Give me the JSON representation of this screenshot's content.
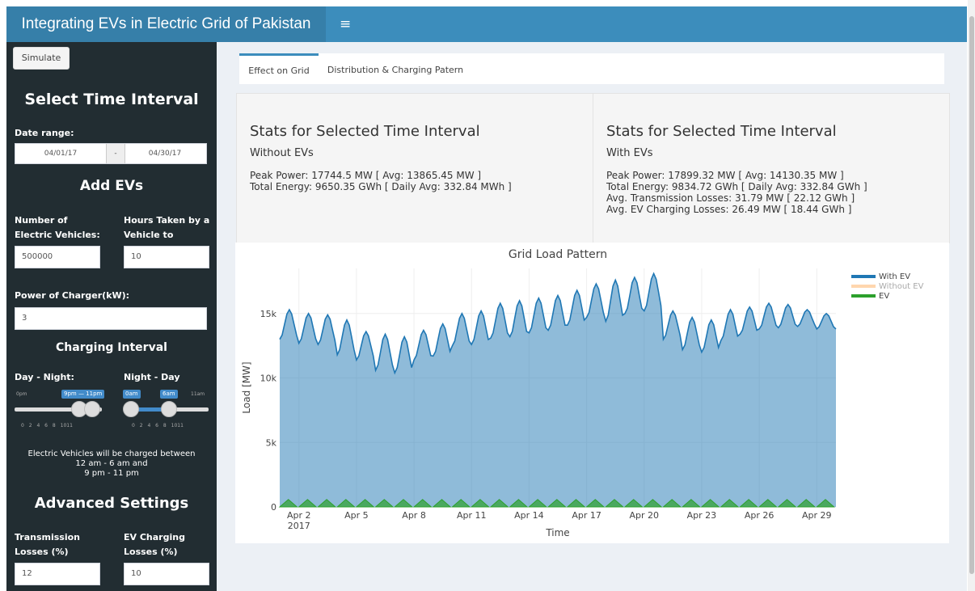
{
  "header": {
    "title": "Integrating EVs in Electric Grid of Pakistan",
    "menu_icon": "≡"
  },
  "sidebar": {
    "simulate_label": "Simulate",
    "time_heading": "Select Time Interval",
    "date_label": "Date range:",
    "date_start": "04/01/17",
    "date_sep": "-",
    "date_end": "04/30/17",
    "evs_heading": "Add EVs",
    "num_ev_label": "Number of Electric Vehicles:",
    "num_ev_value": "500000",
    "hours_label": "Hours Taken by a Vehicle to Charge:",
    "hours_value": "10",
    "power_label": "Power of Charger(kW):",
    "power_value": "3",
    "charging_heading": "Charging Interval",
    "day_night_label": "Day - Night:",
    "night_day_label": "Night - Day",
    "dn_min": "0pm",
    "dn_badge": "9pm — 11pm",
    "nd_badge_from": "0am",
    "nd_badge_to": "6am",
    "nd_max": "11am",
    "dn_ticks": "0 2 4 6 8 1011",
    "nd_ticks": "0 2 4 6 8 1011",
    "charge_msg_1": "Electric Vehicles will be charged between",
    "charge_msg_2": "12 am - 6 am and",
    "charge_msg_3": "9 pm - 11 pm",
    "advanced_heading": "Advanced Settings",
    "trans_label": "Transmission Losses (%)",
    "trans_value": "12",
    "evloss_label": "EV Charging Losses (%)",
    "evloss_value": "10"
  },
  "tabs": [
    {
      "label": "Effect on Grid",
      "active": true
    },
    {
      "label": "Distribution & Charging Patern",
      "active": false
    }
  ],
  "stats_without": {
    "title": "Stats for Selected Time Interval",
    "subtitle": "Without EVs",
    "lines": [
      "Peak Power: 17744.5 MW [ Avg: 13865.45 MW ]",
      "Total Energy: 9650.35 GWh [ Daily Avg: 332.84 MWh ]"
    ]
  },
  "stats_with": {
    "title": "Stats for Selected Time Interval",
    "subtitle": "With EVs",
    "lines": [
      "Peak Power: 17899.32 MW [ Avg: 14130.35 MW ]",
      "Total Energy: 9834.72 GWh [ Daily Avg: 332.84 GWh ]",
      "Avg. Transmission Losses: 31.79 MW [ 22.12 GWh ]",
      "Avg. EV Charging Losses: 26.49 MW [ 18.44 GWh ]"
    ]
  },
  "chart_data": {
    "type": "area",
    "title": "Grid Load Pattern",
    "xlabel": "Time",
    "ylabel": "Load [MW]",
    "ylim": [
      0,
      18500
    ],
    "x_ticks": [
      "Apr 2",
      "Apr 5",
      "Apr 8",
      "Apr 11",
      "Apr 14",
      "Apr 17",
      "Apr 20",
      "Apr 23",
      "Apr 26",
      "Apr 29"
    ],
    "x_tick_days": [
      2,
      5,
      8,
      11,
      14,
      17,
      20,
      23,
      26,
      29
    ],
    "x_year_label": "2017",
    "y_ticks": [
      0,
      5000,
      10000,
      15000
    ],
    "y_tick_labels": [
      "0",
      "5k",
      "10k",
      "15k"
    ],
    "x_range_days": [
      1,
      30
    ],
    "legend_position": "right",
    "grid": true,
    "series": [
      {
        "name": "With EV",
        "color": "#1f77b4",
        "daily_min": [
          13000,
          12700,
          12600,
          11800,
          11400,
          10600,
          10400,
          11400,
          11700,
          12500,
          12600,
          13100,
          13200,
          13500,
          13700,
          14100,
          14700,
          14400,
          15000,
          15200,
          13000,
          12200,
          12000,
          12900,
          13400,
          13800,
          13900,
          14000,
          13800
        ],
        "daily_max": [
          15300,
          15000,
          14900,
          14500,
          13600,
          13400,
          13200,
          13700,
          14200,
          15000,
          15200,
          15800,
          16000,
          16200,
          16400,
          16800,
          17300,
          17600,
          17800,
          18100,
          15200,
          14700,
          14500,
          15300,
          15500,
          15800,
          15700,
          15300,
          15000
        ]
      },
      {
        "name": "Without EV",
        "color": "#ffbb78"
      },
      {
        "name": "EV",
        "color": "#2ca02c",
        "daily_peak": 580
      }
    ]
  }
}
